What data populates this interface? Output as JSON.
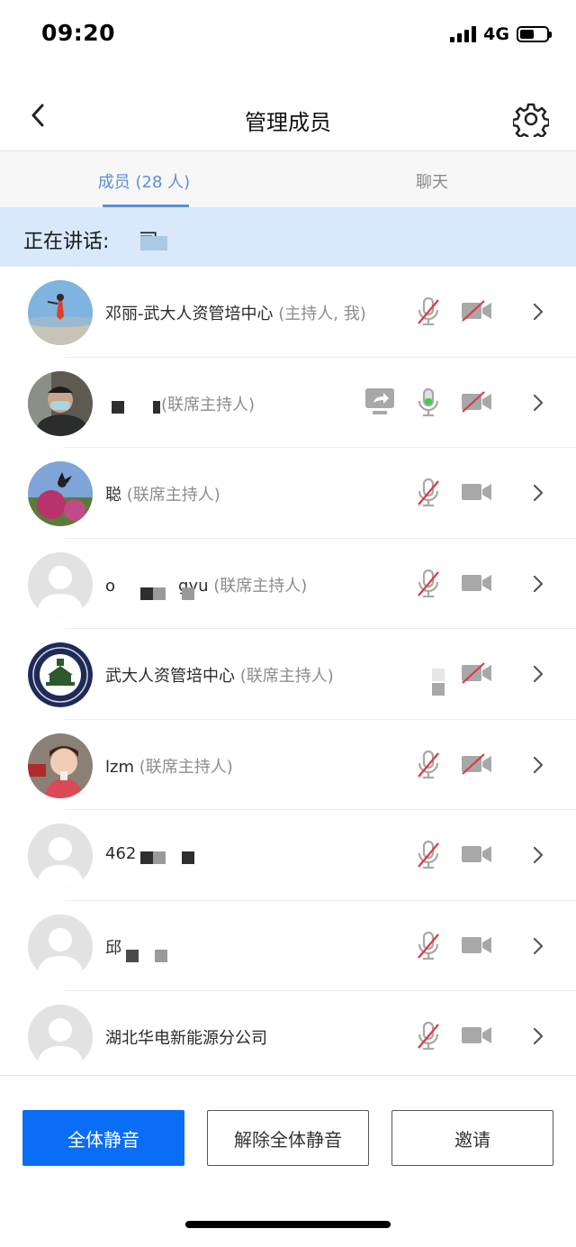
{
  "status_bar": {
    "time": "09:20",
    "network": "4G",
    "battery_level": 0.55
  },
  "nav": {
    "title": "管理成员",
    "back_icon": "chevron-left-icon",
    "settings_icon": "gear-icon"
  },
  "tabs": [
    {
      "label": "成员 (28 人)",
      "active": true
    },
    {
      "label": "聊天",
      "active": false
    }
  ],
  "speaking": {
    "label": "正在讲话:",
    "name": "司;"
  },
  "members": [
    {
      "name": "邓丽-武大人资管培中心",
      "role": "(主持人, 我)",
      "avatar": "photo",
      "mic": "muted",
      "camera": "off",
      "sharing": false
    },
    {
      "name": "",
      "role": "(联席主持人)",
      "avatar": "photo",
      "mic": "speaking",
      "camera": "off",
      "sharing": true
    },
    {
      "name": "聪",
      "role": "(联席主持人)",
      "avatar": "photo",
      "mic": "muted",
      "camera": "on",
      "sharing": false
    },
    {
      "name": "o",
      "name_suffix": "gyu",
      "role": "(联席主持人)",
      "avatar": "default",
      "mic": "muted",
      "camera": "on",
      "sharing": false
    },
    {
      "name": "武大人资管培中心",
      "role": "(联席主持人)",
      "avatar": "emblem",
      "mic": "none",
      "camera": "off",
      "sharing": false
    },
    {
      "name": "lzm",
      "role": "(联席主持人)",
      "avatar": "photo",
      "mic": "muted",
      "camera": "off",
      "sharing": false
    },
    {
      "name": "462",
      "role": "",
      "avatar": "default",
      "mic": "muted",
      "camera": "on",
      "sharing": false
    },
    {
      "name": "邱",
      "role": "",
      "avatar": "default",
      "mic": "muted",
      "camera": "on",
      "sharing": false
    },
    {
      "name": "湖北华电新能源分公司",
      "role": "",
      "avatar": "default",
      "mic": "muted",
      "camera": "on",
      "sharing": false
    }
  ],
  "actions": {
    "mute_all": "全体静音",
    "unmute_all": "解除全体静音",
    "invite": "邀请"
  },
  "colors": {
    "accent": "#0a6df5",
    "tab_active": "#5b8fd6",
    "speaking_bg": "#d9e9fb",
    "mute_red": "#e0393e",
    "speaking_green": "#3ecf4a"
  }
}
